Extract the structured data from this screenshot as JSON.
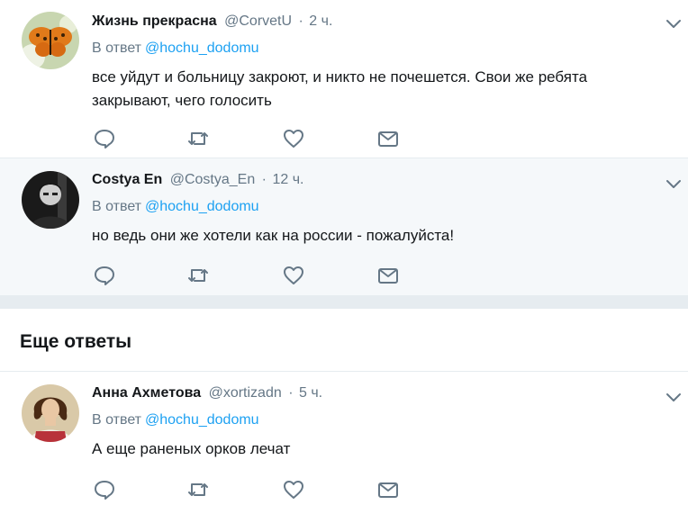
{
  "tweets": [
    {
      "name": "Жизнь прекрасна",
      "handle": "@CorvetU",
      "sep": "·",
      "time": "2 ч.",
      "reply_prefix": "В ответ",
      "reply_mention": "@hochu_dodomu",
      "text": "все уйдут и больницу закроют, и никто не почешется. Свои же ребята закрывают, чего голосить",
      "avatar": "butterfly-avatar"
    },
    {
      "name": "Costya En",
      "handle": "@Costya_En",
      "sep": "·",
      "time": "12 ч.",
      "reply_prefix": "В ответ",
      "reply_mention": "@hochu_dodomu",
      "text": "но ведь они же хотели как на россии - пожалуйста!",
      "avatar": "person-dark-avatar"
    },
    {
      "name": "Анна Ахметова",
      "handle": "@xortizadn",
      "sep": "·",
      "time": "5 ч.",
      "reply_prefix": "В ответ",
      "reply_mention": "@hochu_dodomu",
      "text": "А еще раненых орков лечат",
      "avatar": "woman-painting-avatar"
    }
  ],
  "more_replies_title": "Еще ответы",
  "icons": {
    "reply": "reply-icon",
    "retweet": "retweet-icon",
    "like": "like-icon",
    "message": "message-icon",
    "caret": "chevron-down-icon"
  },
  "colors": {
    "link": "#1da1f2",
    "secondary_text": "#657786",
    "icon": "#657786",
    "highlight_bg": "#f5f8fa",
    "border": "#e6ecf0"
  }
}
